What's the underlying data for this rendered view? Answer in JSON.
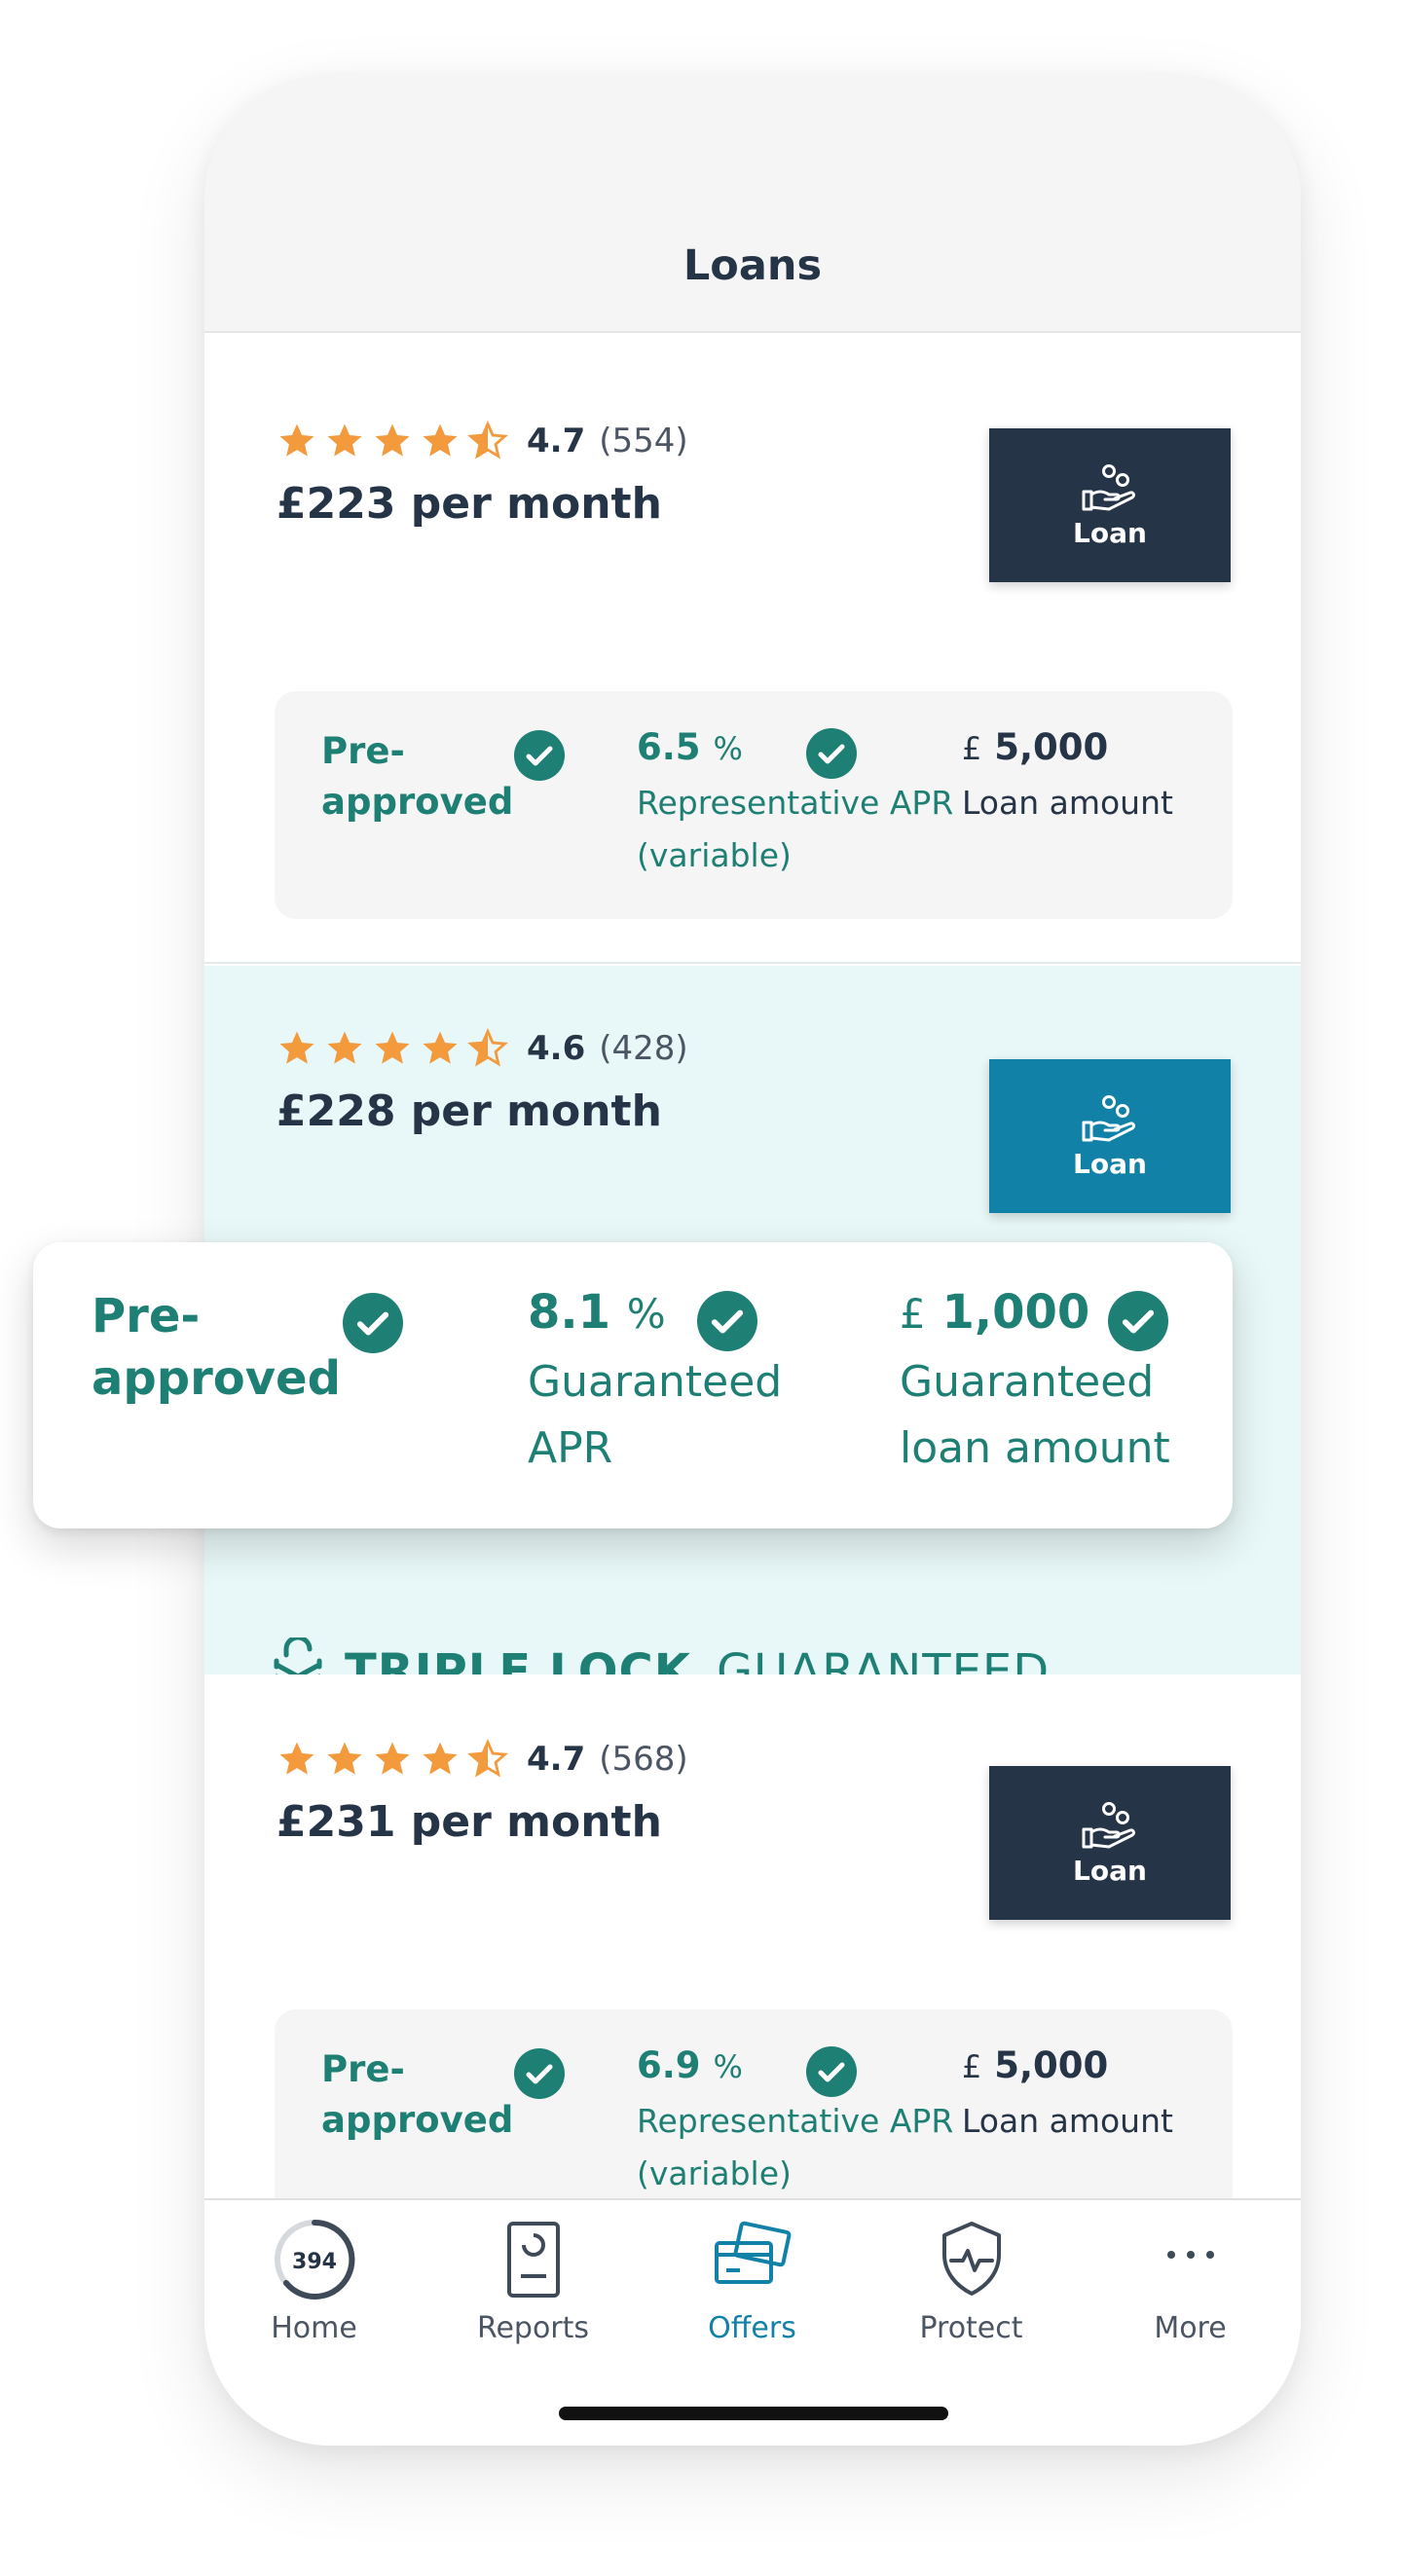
{
  "header": {
    "title": "Loans"
  },
  "loans": [
    {
      "rating": "4.7",
      "reviews": "(554)",
      "price": "£223 per month",
      "button_label": "Loan",
      "pre_approved": "Pre-approved",
      "apr_value": "6.5",
      "apr_unit": "%",
      "apr_desc": "Representative APR (variable)",
      "amount_currency": "£",
      "amount_value": "5,000",
      "amount_desc": "Loan amount"
    },
    {
      "rating": "4.6",
      "reviews": "(428)",
      "price": "£228 per month",
      "button_label": "Loan"
    },
    {
      "rating": "4.7",
      "reviews": "(568)",
      "price": "£231 per month",
      "button_label": "Loan",
      "pre_approved": "Pre-approved",
      "apr_value": "6.9",
      "apr_unit": "%",
      "apr_desc": "Representative APR (variable)",
      "amount_currency": "£",
      "amount_value": "5,000",
      "amount_desc": "Loan amount"
    }
  ],
  "guaranteed_card": {
    "pre_approved": "Pre-approved",
    "apr_value": "8.1",
    "apr_unit": "%",
    "apr_desc": "Guaranteed APR",
    "amount_currency": "£",
    "amount_value": "1,000",
    "amount_desc": "Guaranteed loan amount"
  },
  "triple_lock": {
    "bold": "TRIPLE LOCK",
    "light": "GUARANTEED"
  },
  "tabs": [
    {
      "label": "Home",
      "badge": "394"
    },
    {
      "label": "Reports"
    },
    {
      "label": "Offers"
    },
    {
      "label": "Protect"
    },
    {
      "label": "More"
    }
  ],
  "colors": {
    "navy": "#263447",
    "teal": "#1e7f74",
    "blue": "#1281a8",
    "star": "#f39a3d",
    "highlight_bg": "#e8f7f7"
  }
}
